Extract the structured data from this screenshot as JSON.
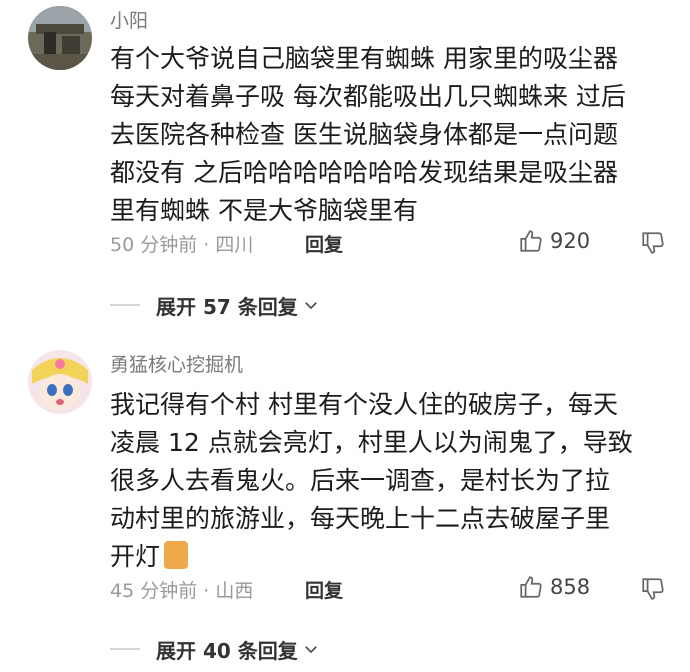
{
  "comments": [
    {
      "username": "小阳",
      "lines": [
        "有个大爷说自己脑袋里有蜘蛛 用家里的吸尘器",
        "每天对着鼻子吸 每次都能吸出几只蜘蛛来 过后",
        "去医院各种检查 医生说脑袋身体都是一点问题",
        "都没有 之后哈哈哈哈哈哈哈发现结果是吸尘器",
        "里有蜘蛛 不是大爷脑袋里有"
      ],
      "time_location": "50 分钟前 · 四川",
      "reply_label": "回复",
      "like_count": "920",
      "expand_label": "展开 57 条回复"
    },
    {
      "username": "勇猛核心挖掘机",
      "lines": [
        "我记得有个村 村里有个没人住的破房子，每天",
        "凌晨 12 点就会亮灯，村里人以为闹鬼了，导致",
        "很多人去看鬼火。后来一调查，是村长为了拉",
        "动村里的旅游业，每天晚上十二点去破屋子里",
        "开灯"
      ],
      "time_location": "45 分钟前 · 山西",
      "reply_label": "回复",
      "like_count": "858",
      "expand_label": "展开 40 条回复"
    }
  ],
  "icons": {
    "like": "thumbs-up-icon",
    "dislike": "thumbs-down-icon",
    "expand": "chevron-down-icon"
  }
}
